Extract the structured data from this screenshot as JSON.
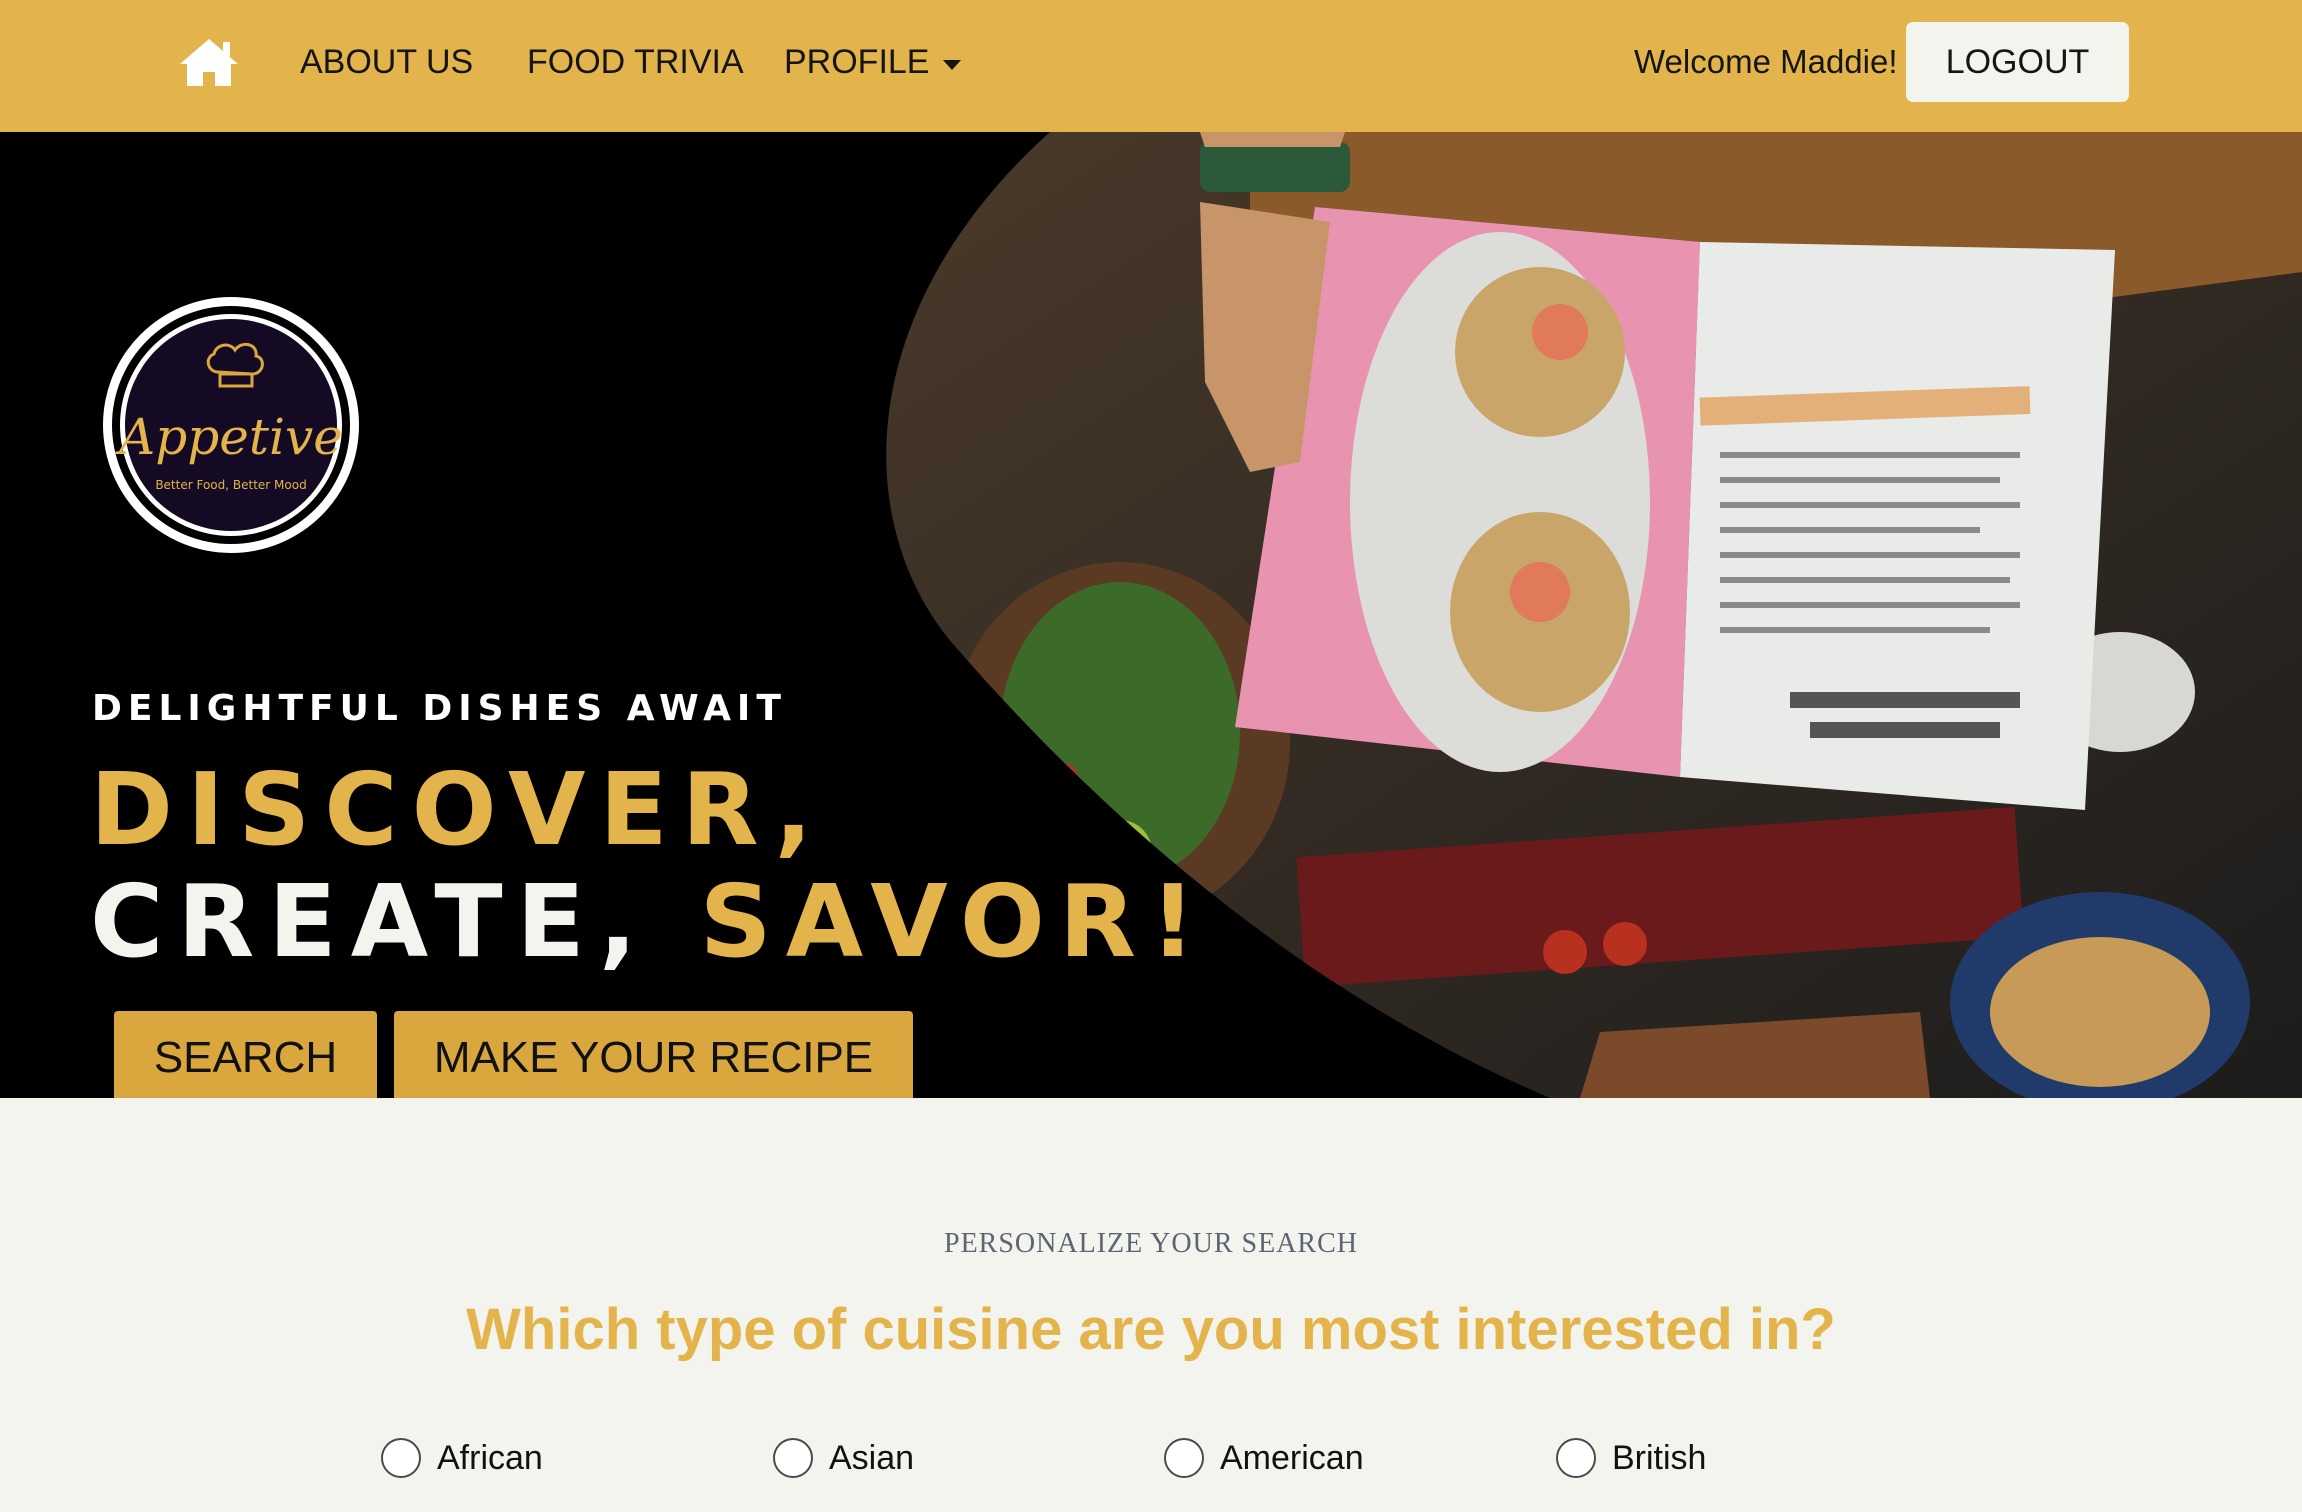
{
  "nav": {
    "home_icon": "home-icon",
    "about": "ABOUT US",
    "trivia": "FOOD TRIVIA",
    "profile": "PROFILE",
    "profile_caret_icon": "caret-down-icon",
    "welcome": "Welcome Maddie!",
    "logout": "LOGOUT"
  },
  "hero": {
    "logo": {
      "name": "Appetive",
      "tagline": "Better Food, Better Mood",
      "icon": "chef-hat-icon"
    },
    "kicker": "DELIGHTFUL DISHES AWAIT",
    "headline_1": "DISCOVER,",
    "headline_2a": "CREATE,",
    "headline_2b": "SAVOR!",
    "search_button": "SEARCH",
    "make_button": "MAKE YOUR RECIPE"
  },
  "personalize": {
    "kicker": "PERSONALIZE YOUR SEARCH",
    "question": "Which type of cuisine are you most interested in?",
    "options": [
      "African",
      "Asian",
      "American",
      "British"
    ]
  },
  "colors": {
    "accent": "#e3b44b",
    "button": "#d9a73d",
    "background": "#f4f4ef",
    "hero_bg": "#000000"
  }
}
